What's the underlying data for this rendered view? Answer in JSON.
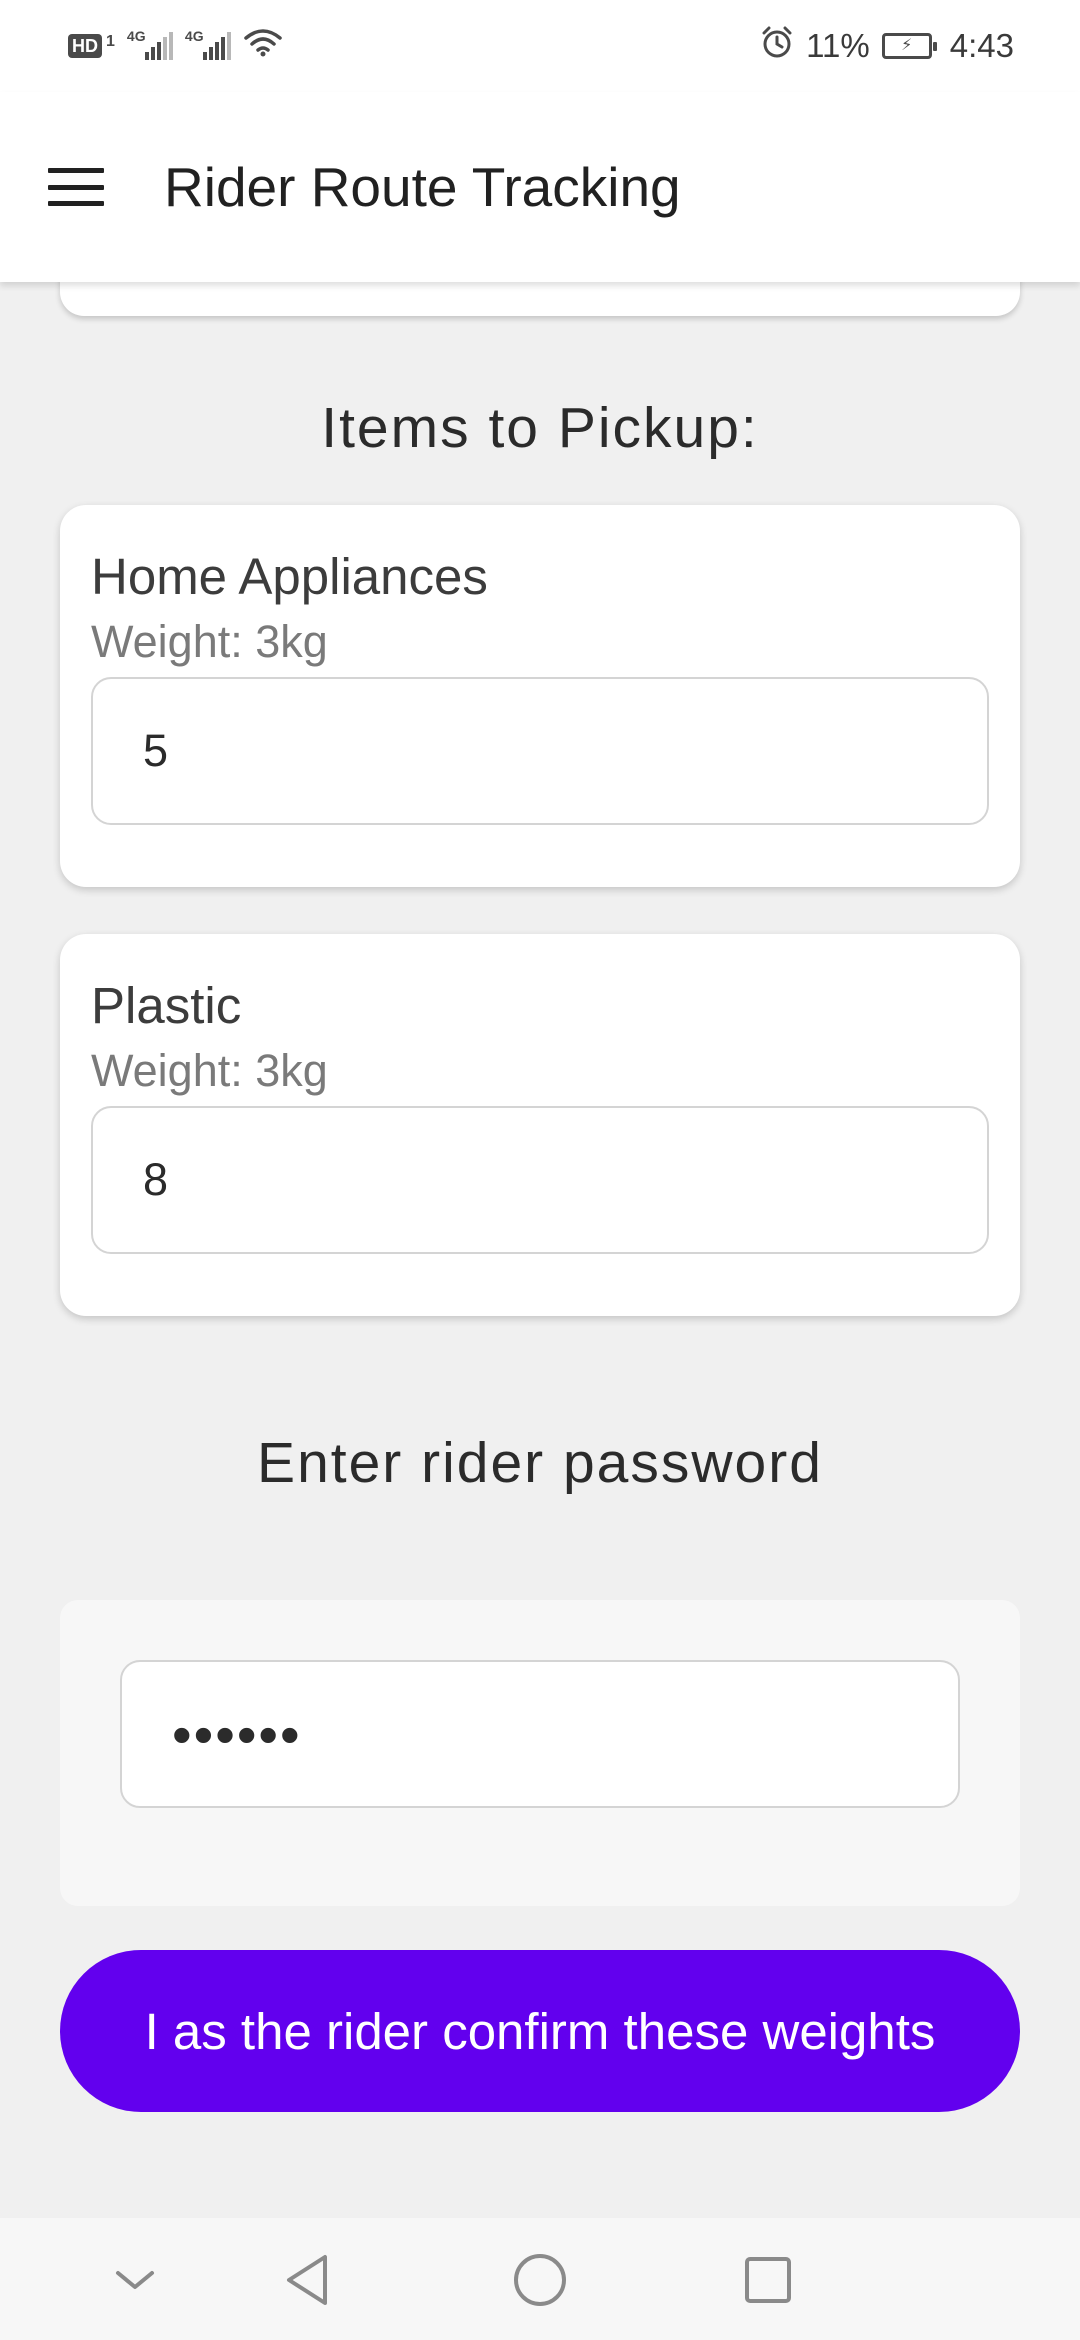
{
  "status_bar": {
    "hd": "HD",
    "sim": "1",
    "network_1": "4G",
    "network_2": "4G",
    "battery_percent": "11%",
    "time": "4:43"
  },
  "app_bar": {
    "title": "Rider Route Tracking"
  },
  "items_section": {
    "title": "Items to Pickup:",
    "items": [
      {
        "name": "Home Appliances",
        "weight_label": "Weight: 3kg",
        "input_value": "5"
      },
      {
        "name": "Plastic",
        "weight_label": "Weight: 3kg",
        "input_value": "8"
      }
    ]
  },
  "password_section": {
    "title": "Enter rider password",
    "value": "••••••"
  },
  "confirm_button": {
    "label": "I as the rider confirm these weights",
    "color": "#6200ee"
  },
  "nav_bar": {
    "icons": [
      "chevron-down-icon",
      "back-icon",
      "home-icon",
      "recents-icon"
    ]
  }
}
